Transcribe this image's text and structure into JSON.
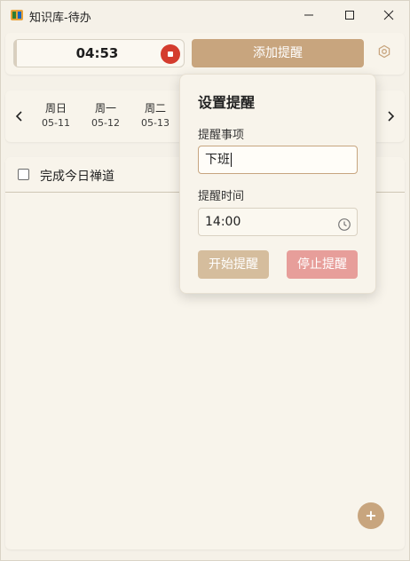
{
  "window": {
    "title": "知识库-待办"
  },
  "toolbar": {
    "timer": "04:53",
    "add_reminder_label": "添加提醒"
  },
  "date_strip": {
    "days": [
      {
        "name": "周日",
        "date": "05-11"
      },
      {
        "name": "周一",
        "date": "05-12"
      },
      {
        "name": "周二",
        "date": "05-13"
      }
    ]
  },
  "todos": {
    "items": [
      {
        "label": "完成今日禅道",
        "checked": false
      }
    ],
    "add_label": "+"
  },
  "reminder_popup": {
    "title": "设置提醒",
    "item_label": "提醒事项",
    "item_value": "下班",
    "time_label": "提醒时间",
    "time_value": "14:00",
    "start_label": "开始提醒",
    "stop_label": "停止提醒"
  },
  "colors": {
    "accent": "#c8a57e",
    "stop_red": "#d43c2e",
    "stop_button": "#e79e9a",
    "background": "#f5f1e8"
  },
  "icons": [
    "app-icon",
    "minimize-icon",
    "maximize-icon",
    "close-icon",
    "stop-icon",
    "settings-icon",
    "chevron-left-icon",
    "chevron-right-icon",
    "clock-icon",
    "plus-icon"
  ]
}
